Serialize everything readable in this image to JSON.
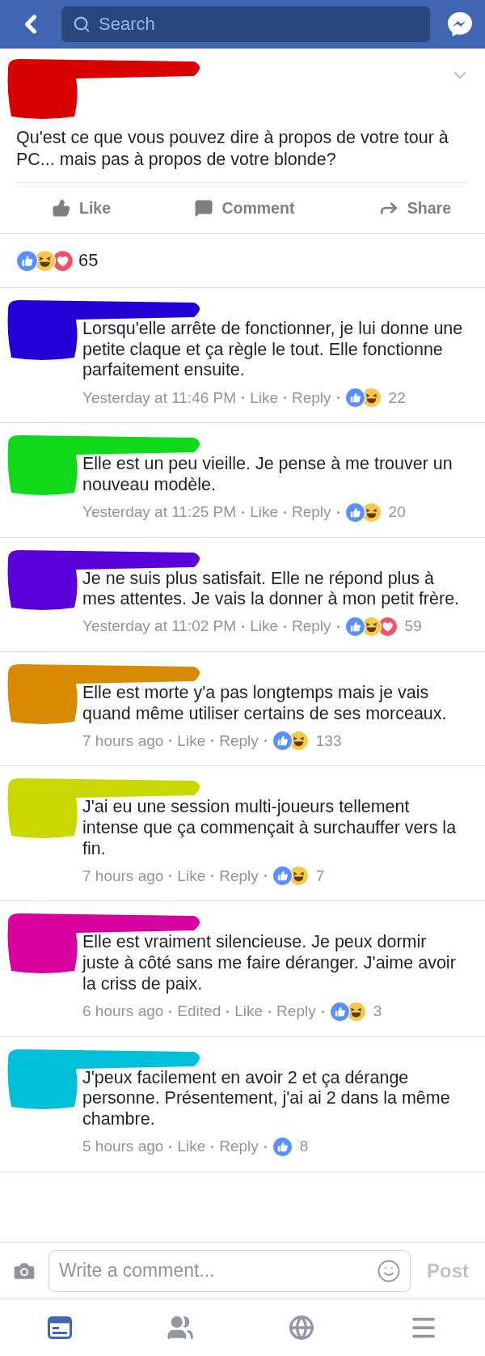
{
  "top_bar": {
    "search": {
      "placeholder": "Search"
    }
  },
  "post": {
    "color": "#d80000",
    "text": "Qu'est ce que vous pouvez dire à propos de votre tour à PC... mais pas à propos de votre blonde?",
    "actions": [
      {
        "kind": "like",
        "label": "Like"
      },
      {
        "kind": "comment",
        "label": "Comment"
      },
      {
        "kind": "share",
        "label": "Share"
      }
    ]
  },
  "reactions": {
    "types": [
      {
        "kind": "like"
      },
      {
        "kind": "haha"
      },
      {
        "kind": "love"
      }
    ],
    "count": "65"
  },
  "comments": [
    {
      "color": "#2200d6",
      "text": "Lorsqu'elle arrête de fonctionner, je lui donne une petite claque et ça règle le tout. Elle fonctionne parfaitement ensuite.",
      "time": "Yesterday at 11:46 PM",
      "links": [
        "Like",
        "Reply"
      ],
      "reactions": [
        {
          "kind": "like"
        },
        {
          "kind": "haha"
        }
      ],
      "count": "22"
    },
    {
      "color": "#10d81a",
      "text": "Elle est un peu vieille. Je pense à me trouver un nouveau modèle.",
      "time": "Yesterday at 11:25 PM",
      "links": [
        "Like",
        "Reply"
      ],
      "reactions": [
        {
          "kind": "like"
        },
        {
          "kind": "haha"
        }
      ],
      "count": "20"
    },
    {
      "color": "#5a00d8",
      "text": "Je ne suis plus satisfait. Elle ne répond plus à mes attentes. Je vais la donner à mon petit frère.",
      "time": "Yesterday at 11:02 PM",
      "links": [
        "Like",
        "Reply"
      ],
      "reactions": [
        {
          "kind": "like"
        },
        {
          "kind": "haha"
        },
        {
          "kind": "love"
        }
      ],
      "count": "59"
    },
    {
      "color": "#d88a00",
      "text": "Elle est morte y'a pas longtemps mais je vais quand même utiliser certains de ses morceaux.",
      "time": "7 hours ago",
      "links": [
        "Like",
        "Reply"
      ],
      "reactions": [
        {
          "kind": "like"
        },
        {
          "kind": "haha"
        }
      ],
      "count": "133"
    },
    {
      "color": "#c8d800",
      "text": "J'ai eu une session multi-joueurs tellement intense que ça commençait à surchauffer vers la fin.",
      "time": "7 hours ago",
      "links": [
        "Like",
        "Reply"
      ],
      "reactions": [
        {
          "kind": "like"
        },
        {
          "kind": "haha"
        }
      ],
      "count": "7"
    },
    {
      "color": "#d8009e",
      "text": "Elle est vraiment silencieuse. Je peux dormir juste à côté sans me faire déranger. J'aime avoir la criss de paix.",
      "time": "6 hours ago",
      "edited": "Edited",
      "links": [
        "Like",
        "Reply"
      ],
      "reactions": [
        {
          "kind": "like"
        },
        {
          "kind": "haha"
        }
      ],
      "count": "3"
    },
    {
      "color": "#00bfd8",
      "text": "J'peux facilement en avoir 2 et ça dérange personne. Présentement, j'ai ai 2 dans la même chambre.",
      "time": "5 hours ago",
      "links": [
        "Like",
        "Reply"
      ],
      "reactions": [
        {
          "kind": "like"
        }
      ],
      "count": "8"
    }
  ],
  "composer": {
    "placeholder": "Write a comment...",
    "post_label": "Post",
    "post_disabled": true
  },
  "tab_bar": [
    {
      "kind": "feed",
      "selected": true
    },
    {
      "kind": "friends",
      "selected": false
    },
    {
      "kind": "globe",
      "selected": false
    },
    {
      "kind": "menu",
      "selected": false
    }
  ]
}
